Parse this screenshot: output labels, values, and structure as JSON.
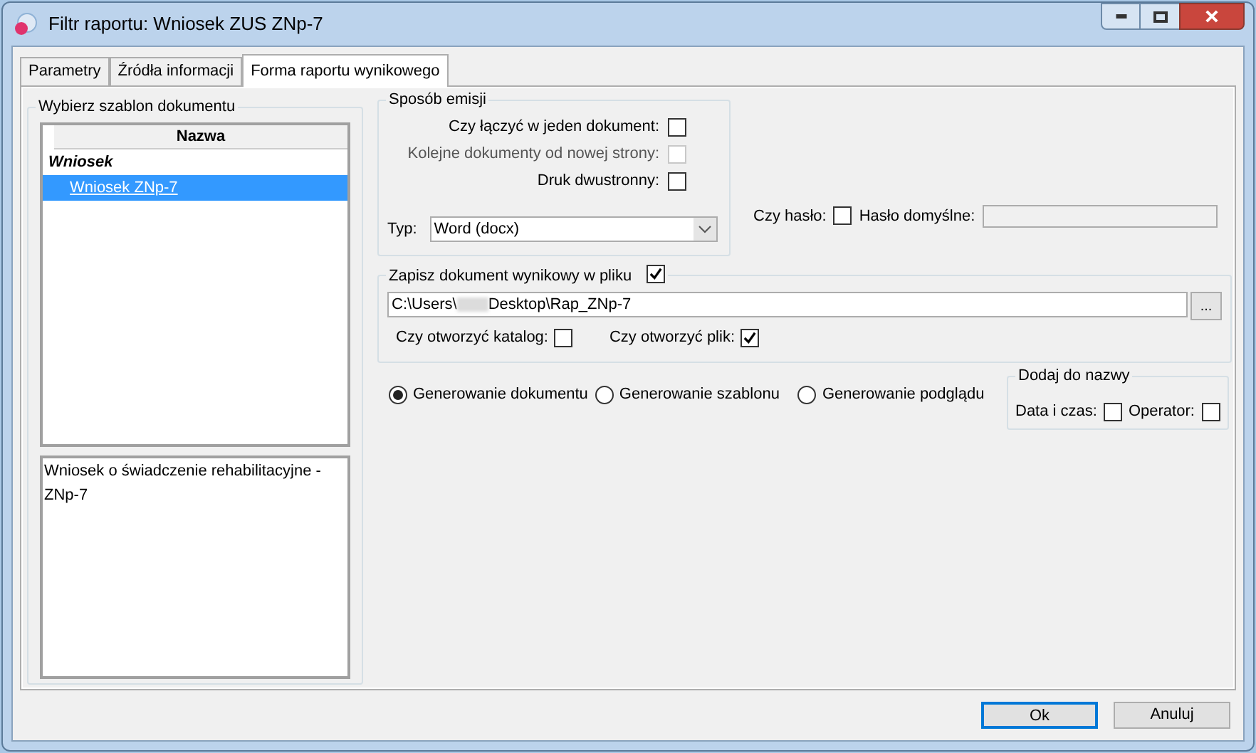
{
  "window": {
    "title": "Filtr raportu: Wniosek ZUS ZNp-7"
  },
  "tabs": [
    {
      "label": "Parametry",
      "selected": false
    },
    {
      "label": "Źródła informacji",
      "selected": false
    },
    {
      "label": "Forma raportu wynikowego",
      "selected": true
    }
  ],
  "template_group": {
    "title": "Wybierz szablon dokumentu",
    "column": "Nazwa",
    "items": [
      {
        "label": "Wniosek",
        "kind": "group",
        "selected": false
      },
      {
        "label": "Wniosek ZNp-7",
        "kind": "item",
        "selected": true
      }
    ],
    "description": "Wniosek o świadczenie rehabilitacyjne - ZNp-7"
  },
  "emission": {
    "title": "Sposób emisji",
    "options": [
      {
        "label": "Czy łączyć w jeden dokument:",
        "checked": false,
        "disabled": false
      },
      {
        "label": "Kolejne dokumenty od nowej strony:",
        "checked": false,
        "disabled": true
      },
      {
        "label": "Druk dwustronny:",
        "checked": false,
        "disabled": false
      }
    ],
    "type_label": "Typ:",
    "type_value": "Word (docx)"
  },
  "password": {
    "label": "Czy hasło:",
    "checked": false,
    "default_label": "Hasło domyślne:"
  },
  "save": {
    "title": "Zapisz dokument wynikowy w pliku",
    "checked": true,
    "path_start": "C:\\Users\\",
    "path_end": "Desktop\\Rap_ZNp-7",
    "browse": "...",
    "open_folder": {
      "label": "Czy otworzyć katalog:",
      "checked": false
    },
    "open_file": {
      "label": "Czy otworzyć plik:",
      "checked": true
    }
  },
  "modes": [
    {
      "label": "Generowanie dokumentu",
      "selected": true
    },
    {
      "label": "Generowanie szablonu",
      "selected": false
    },
    {
      "label": "Generowanie podglądu",
      "selected": false
    }
  ],
  "add_to_name": {
    "title": "Dodaj do nazwy",
    "options": [
      {
        "label": "Data i czas:",
        "checked": false
      },
      {
        "label": "Operator:",
        "checked": false
      }
    ]
  },
  "buttons": [
    {
      "label": "Ok",
      "default": true
    },
    {
      "label": "Anuluj",
      "default": false
    }
  ]
}
